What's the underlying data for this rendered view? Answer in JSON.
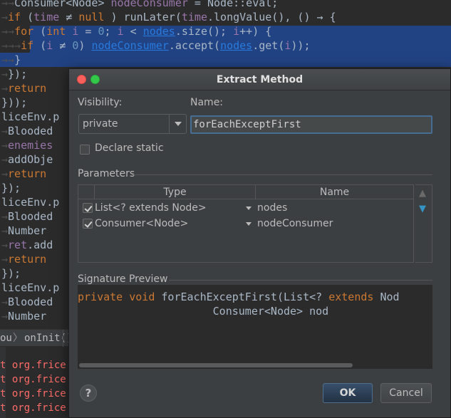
{
  "editor": {
    "arrow_glyph": "→",
    "lines": [
      {
        "arrows": "→→",
        "html_parts": [
          [
            "",
            "Consumer<Node> "
          ],
          [
            "fld",
            "nodeConsumer"
          ],
          [
            "",
            " = Node::eval;"
          ]
        ]
      },
      {
        "arrows": "→",
        "html_parts": [
          [
            "kw",
            "if"
          ],
          [
            "",
            " ("
          ],
          [
            "fld",
            "time"
          ],
          [
            "",
            " ≠ "
          ],
          [
            "kw",
            "null"
          ],
          [
            "",
            " ) runLater("
          ],
          [
            "fld",
            "time"
          ],
          [
            "",
            ".longValue(), () → {"
          ]
        ]
      },
      {
        "arrows": "→→",
        "html_parts": [
          [
            "kw",
            "for"
          ],
          [
            "",
            " ("
          ],
          [
            "kw",
            "int"
          ],
          [
            "",
            " "
          ],
          [
            "fld",
            "i"
          ],
          [
            "",
            " = "
          ],
          [
            "num",
            "0"
          ],
          [
            "",
            "; "
          ],
          [
            "fld",
            "i"
          ],
          [
            "",
            " < "
          ],
          [
            "lnk",
            "nodes"
          ],
          [
            "",
            ".size(); "
          ],
          [
            "fld",
            "i"
          ],
          [
            "",
            "++) {"
          ]
        ]
      },
      {
        "arrows": "→→→",
        "html_parts": [
          [
            "kw",
            "if"
          ],
          [
            "",
            " ("
          ],
          [
            "fld",
            "i"
          ],
          [
            "",
            " ≠ "
          ],
          [
            "num",
            "0"
          ],
          [
            "",
            ") "
          ],
          [
            "lnk",
            "nodeConsumer"
          ],
          [
            "",
            ".accept("
          ],
          [
            "lnk",
            "nodes"
          ],
          [
            "",
            ".get("
          ],
          [
            "fld",
            "i"
          ],
          [
            "",
            "));"
          ]
        ]
      },
      {
        "arrows": "→→",
        "html_parts": [
          [
            "",
            "}"
          ]
        ]
      },
      {
        "arrows": "→",
        "html_parts": [
          [
            "",
            "});"
          ]
        ]
      },
      {
        "arrows": "→",
        "html_parts": [
          [
            "kw",
            "return"
          ]
        ]
      },
      {
        "arrows": "",
        "html_parts": [
          [
            "",
            "}));"
          ]
        ]
      },
      {
        "arrows": "",
        "html_parts": [
          [
            "",
            "liceEnv.p"
          ]
        ]
      },
      {
        "arrows": "→",
        "html_parts": [
          [
            "",
            "Blooded"
          ]
        ]
      },
      {
        "arrows": "→",
        "html_parts": [
          [
            "fld",
            "enemies"
          ]
        ]
      },
      {
        "arrows": "→",
        "html_parts": [
          [
            "",
            "addObje"
          ]
        ]
      },
      {
        "arrows": "→",
        "html_parts": [
          [
            "kw",
            "return"
          ]
        ]
      },
      {
        "arrows": "",
        "html_parts": [
          [
            "",
            "});"
          ]
        ]
      },
      {
        "arrows": "",
        "html_parts": [
          [
            "",
            "liceEnv.p"
          ]
        ]
      },
      {
        "arrows": "→",
        "html_parts": [
          [
            "",
            "Blooded"
          ]
        ]
      },
      {
        "arrows": "→",
        "html_parts": [
          [
            "",
            "Number"
          ]
        ]
      },
      {
        "arrows": "→",
        "html_parts": [
          [
            "fld",
            "ret"
          ],
          [
            "",
            ".add"
          ]
        ]
      },
      {
        "arrows": "→",
        "html_parts": [
          [
            "kw",
            "return"
          ]
        ]
      },
      {
        "arrows": "",
        "html_parts": [
          [
            "",
            "});"
          ]
        ]
      },
      {
        "arrows": "",
        "html_parts": [
          [
            "",
            "liceEnv.p"
          ]
        ]
      },
      {
        "arrows": "→",
        "html_parts": [
          [
            "",
            "Blooded"
          ]
        ]
      },
      {
        "arrows": "→",
        "html_parts": [
          [
            "",
            "Number"
          ]
        ]
      }
    ],
    "right_overflow": "on"
  },
  "breadcrumb": {
    "first": "ou",
    "separator": "〉",
    "second": "onInit()"
  },
  "console": {
    "lines": [
      "t org.frice.",
      "t org.frice.",
      "t org.frice.p",
      "t org.frice."
    ]
  },
  "dialog": {
    "title": "Extract Method",
    "visibility_label": "Visibility:",
    "visibility_value": "private",
    "name_label": "Name:",
    "name_value": "forEachExceptFirst",
    "declare_static_label": "Declare static",
    "declare_static_checked": false,
    "parameters_label": "Parameters",
    "columns": [
      "Type",
      "Name"
    ],
    "parameters": [
      {
        "type": "List<? extends Node>",
        "name": "nodes",
        "checked": true
      },
      {
        "type": "Consumer<Node>",
        "name": "nodeConsumer",
        "checked": true
      }
    ],
    "move_up_icon": "arrow-up-icon",
    "move_down_icon": "arrow-down-icon",
    "signature_label": "Signature Preview",
    "signature_line1_parts": [
      [
        "kw",
        "private"
      ],
      [
        "",
        " "
      ],
      [
        "kw",
        "void"
      ],
      [
        "",
        " forEachExceptFirst(List<? "
      ],
      [
        "kw",
        "extends"
      ],
      [
        "",
        " Nod"
      ]
    ],
    "signature_line2": "                     Consumer<Node> nod",
    "help_label": "?",
    "ok_label": "OK",
    "cancel_label": "Cancel"
  },
  "colors": {
    "accent": "#466d94",
    "selection": "#214283",
    "keyword": "#cc7832"
  }
}
